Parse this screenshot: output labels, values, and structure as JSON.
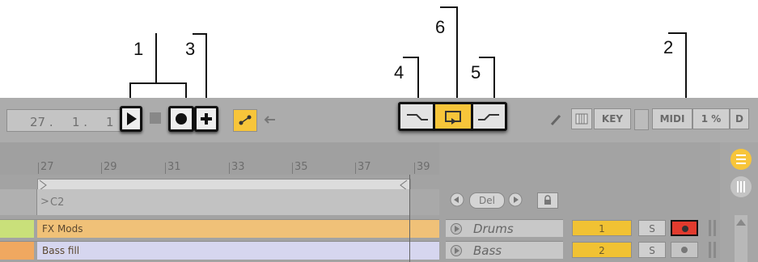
{
  "callouts": {
    "one": "1",
    "two": "2",
    "three": "3",
    "four": "4",
    "five": "5",
    "six": "6"
  },
  "control_bar": {
    "position": {
      "bars": "27 .",
      "beats": "1 .",
      "sixteenths": "1"
    },
    "buttons": {
      "key": "KEY",
      "midi": "MIDI",
      "cpu": "1 %",
      "d": "D"
    }
  },
  "ruler": {
    "ticks": [
      "27",
      "29",
      "31",
      "33",
      "35",
      "37",
      "39"
    ]
  },
  "clip": {
    "note_label": "C2"
  },
  "scene_controls": {
    "del_label": "Del"
  },
  "tracks": [
    {
      "name": "FX Mods",
      "color": "#f0c178",
      "side_color": "#c9e07a",
      "instrument": "Drums",
      "number": "1",
      "solo": "S",
      "armed": true
    },
    {
      "name": "Bass fill",
      "color": "#d6d6ef",
      "side_color": "#f0a860",
      "instrument": "Bass",
      "number": "2",
      "solo": "S",
      "armed": false
    }
  ],
  "colors": {
    "accent_yellow": "#f7c53a",
    "arm_red": "#e23b2e",
    "panel_gray": "#acacac"
  },
  "icons": {
    "play": "play-icon",
    "stop": "stop-icon",
    "record": "record-icon",
    "overdub": "plus-icon",
    "automation": "automation-icon",
    "back": "arrow-left-icon",
    "punch_in": "punch-in-icon",
    "loop": "loop-icon",
    "punch_out": "punch-out-icon",
    "pencil": "pencil-icon",
    "keyboard": "piano-icon",
    "browser": "browser-icon"
  }
}
